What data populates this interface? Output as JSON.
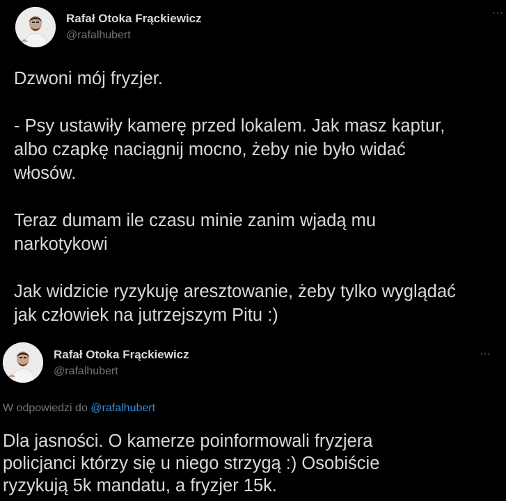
{
  "tweet1": {
    "author_name": "Rafał Otoka Frąckiewicz",
    "author_handle": "@rafalhubert",
    "avatar_icon": "profile-photo",
    "more_icon": "more-dots-icon",
    "more_symbol": "···",
    "text": "Dzwoni mój fryzjer.\n\n- Psy ustawiły kamerę przed lokalem. Jak masz kaptur,\nalbo czapkę naciągnij mocno, żeby nie było widać\nwłosów.\n\nTeraz dumam ile czasu minie zanim wjadą mu\nnarkotykowi\n\nJak widzicie ryzykuję aresztowanie, żeby tylko wyglądać\njak człowiek na jutrzejszym Pitu :)"
  },
  "tweet2": {
    "author_name": "Rafał Otoka Frąckiewicz",
    "author_handle": "@rafalhubert",
    "avatar_icon": "profile-photo",
    "more_icon": "more-dots-icon",
    "more_symbol": "···",
    "reply_prefix": "W odpowiedzi do ",
    "reply_mention": "@rafalhubert",
    "text": "Dla jasności. O kamerze poinformowali fryzjera\npolicjanci którzy się u niego strzygą :) Osobiście\nryzykują 5k mandatu, a fryzjer 15k."
  },
  "colors": {
    "background": "#000000",
    "text": "#d9d9d9",
    "muted": "#6e767d",
    "link": "#3a8ed6"
  }
}
